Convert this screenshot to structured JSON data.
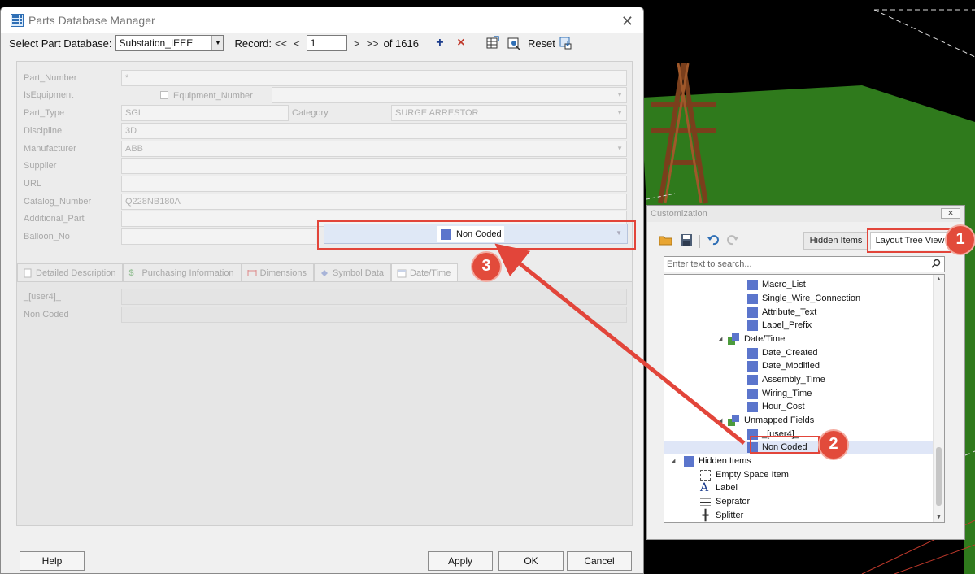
{
  "window": {
    "title": "Parts Database Manager",
    "close": "✕"
  },
  "toolbar": {
    "db_label": "Select Part Database:",
    "db_value": "Substation_IEEE",
    "record_label": "Record:",
    "first": "<<",
    "prev": "<",
    "record_value": "1",
    "next": ">",
    "last": ">>",
    "of_total": "of 1616",
    "add": "+",
    "delete": "×",
    "reset": "Reset"
  },
  "fields": [
    {
      "label": "Part_Number",
      "value": "*"
    },
    {
      "label": "IsEquipment",
      "value": ""
    },
    {
      "label": "Equipment_Number",
      "value": ""
    },
    {
      "label": "Part_Type",
      "value": "SGL"
    },
    {
      "label": "Category",
      "value": "SURGE ARRESTOR"
    },
    {
      "label": "Discipline",
      "value": "3D"
    },
    {
      "label": "Manufacturer",
      "value": "ABB"
    },
    {
      "label": "Supplier",
      "value": ""
    },
    {
      "label": "URL",
      "value": ""
    },
    {
      "label": "Catalog_Number",
      "value": "Q228NB180A"
    },
    {
      "label": "Additional_Part",
      "value": ""
    },
    {
      "label": "Balloon_No",
      "value": ""
    }
  ],
  "tabs": [
    {
      "label": "Detailed Description",
      "icon": "document-icon"
    },
    {
      "label": "Purchasing Information",
      "icon": "dollar-icon"
    },
    {
      "label": "Dimensions",
      "icon": "ruler-icon"
    },
    {
      "label": "Symbol Data",
      "icon": "symbol-icon"
    },
    {
      "label": "Date/Time",
      "icon": "calendar-icon"
    }
  ],
  "tab_fields": [
    {
      "label": "_[user4]_",
      "value": ""
    },
    {
      "label": "Non Coded",
      "value": ""
    }
  ],
  "drag_item": "Non Coded",
  "buttons": {
    "help": "Help",
    "apply": "Apply",
    "ok": "OK",
    "cancel": "Cancel"
  },
  "customization": {
    "title": "Customization",
    "close": "✕",
    "tab_hidden": "Hidden Items",
    "tab_layout": "Layout Tree View",
    "search_placeholder": "Enter text to search...",
    "tree": [
      {
        "label": "Macro_List",
        "kind": "item"
      },
      {
        "label": "Single_Wire_Connection",
        "kind": "item"
      },
      {
        "label": "Attribute_Text",
        "kind": "item"
      },
      {
        "label": "Label_Prefix",
        "kind": "item"
      },
      {
        "label": "Date/Time",
        "kind": "group"
      },
      {
        "label": "Date_Created",
        "kind": "item"
      },
      {
        "label": "Date_Modified",
        "kind": "item"
      },
      {
        "label": "Assembly_Time",
        "kind": "item"
      },
      {
        "label": "Wiring_Time",
        "kind": "item"
      },
      {
        "label": "Hour_Cost",
        "kind": "item"
      },
      {
        "label": "Unmapped Fields",
        "kind": "group"
      },
      {
        "label": "_[user4]_",
        "kind": "item"
      },
      {
        "label": "Non Coded",
        "kind": "item"
      },
      {
        "label": "Hidden Items",
        "kind": "root"
      },
      {
        "label": "Empty Space Item",
        "kind": "hidden"
      },
      {
        "label": "Label",
        "kind": "hidden"
      },
      {
        "label": "Seprator",
        "kind": "hidden"
      },
      {
        "label": "Splitter",
        "kind": "hidden"
      }
    ]
  },
  "callouts": [
    "1",
    "2",
    "3"
  ],
  "colors": {
    "accent_red": "#e2453a",
    "item_blue": "#5b75cc",
    "group_green": "#4c9b3c",
    "terrain_green": "#2f7a1c"
  }
}
